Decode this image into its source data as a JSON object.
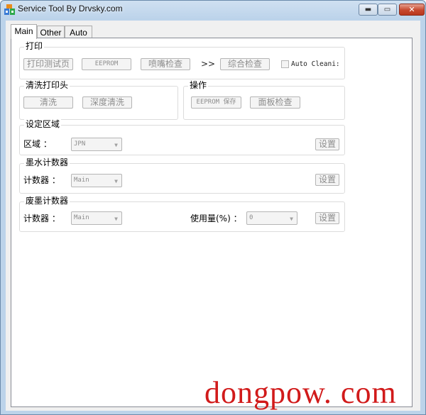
{
  "window": {
    "title": "Service Tool By Drvsky.com",
    "icons": {
      "app": "app-icon",
      "minimize": "minimize-icon",
      "maximize": "maximize-icon",
      "close": "close-icon"
    },
    "minimize_glyph": "▬",
    "maximize_glyph": "▭",
    "close_glyph": "✕"
  },
  "tabs": [
    {
      "label": "Main",
      "active": true
    },
    {
      "label": "Other",
      "active": false
    },
    {
      "label": "Auto",
      "active": false
    }
  ],
  "print_group": {
    "title": "打印",
    "buttons": [
      "打印测试页",
      "EEPROM",
      "喷嘴检查",
      "综合检查"
    ],
    "arrow": ">>",
    "auto_clean_label": "Auto Cleani:",
    "auto_clean_checked": false
  },
  "clean_group": {
    "title": "清洗打印头",
    "buttons": [
      "清洗",
      "深度清洗"
    ]
  },
  "op_group": {
    "title": "操作",
    "buttons": [
      "EEPROM 保存",
      "面板检查"
    ]
  },
  "region_group": {
    "title": "设定区域",
    "label": "区域 ：",
    "select_value": "JPN",
    "set_button": "设置"
  },
  "ink_group": {
    "title": "墨水计数器",
    "label": "计数器 ：",
    "select_value": "Main",
    "set_button": "设置"
  },
  "waste_group": {
    "title": "废墨计数器",
    "label": "计数器 ：",
    "select_value": "Main",
    "usage_label": "使用量(%) ：",
    "usage_value": "0",
    "set_button": "设置"
  },
  "watermark": "dongpow. com"
}
